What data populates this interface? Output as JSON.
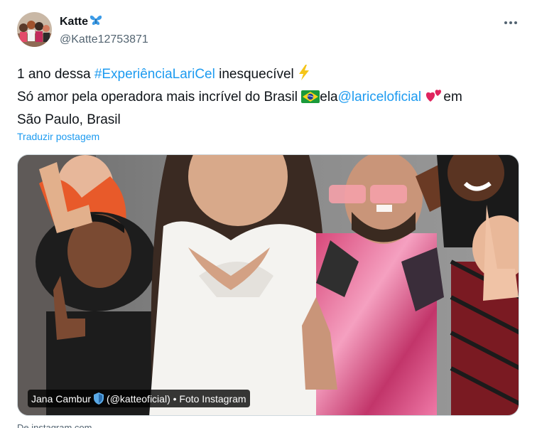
{
  "user": {
    "display_name": "Katte",
    "handle": "@Katte12753871",
    "name_emoji": "butterfly-icon"
  },
  "tweet": {
    "line1_prefix": "1 ano dessa ",
    "hashtag": "#ExperiênciaLariCel",
    "line1_suffix": " inesquecível ",
    "line2_prefix": "Só amor pela operadora mais incrível do Brasil ",
    "line2_mid": "ela",
    "mention": "@lariceloficial",
    "line2_suffix": "em",
    "line3": "São Paulo, Brasil"
  },
  "translate_label": "Traduzir postagem",
  "media": {
    "caption_prefix": "Jana Cambur",
    "caption_suffix": "(@katteoficial) • Foto Instagram"
  },
  "source_label": "De instagram.com",
  "colors": {
    "link": "#1d9bf0",
    "text": "#0f1419",
    "secondary": "#536471"
  }
}
